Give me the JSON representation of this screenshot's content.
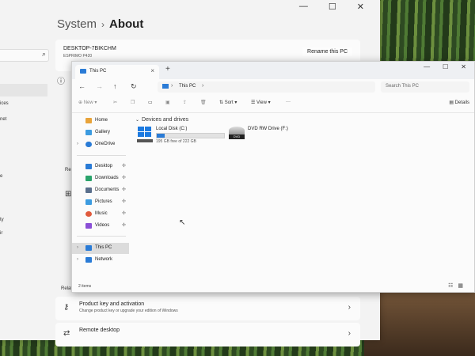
{
  "settings": {
    "breadcrumb": {
      "parent": "System",
      "current": "About"
    },
    "window_controls": [
      "—",
      "☐",
      "✕"
    ],
    "nav_fragments": [
      "ices",
      "net",
      "e",
      "ty",
      "ir"
    ],
    "device": {
      "name": "DESKTOP-7BIKCHM",
      "model": "ESPRIMO P420",
      "rename_label": "Rename this PC"
    },
    "section_label": "Re",
    "related_label": "Related",
    "cards": [
      {
        "title": "Product key and activation",
        "subtitle": "Change product key or upgrade your edition of Windows",
        "icon": "key-icon"
      },
      {
        "title": "Remote desktop",
        "subtitle": "",
        "icon": "remote-desktop-icon"
      }
    ]
  },
  "explorer": {
    "tab_title": "This PC",
    "new_tab": "+",
    "window_controls": [
      "—",
      "☐",
      "✕"
    ],
    "address": {
      "location": "This PC"
    },
    "search_placeholder": "Search This PC",
    "toolbar": {
      "new": "New",
      "sort": "Sort",
      "view": "View",
      "more": "···",
      "details": "Details"
    },
    "nav": [
      {
        "label": "Home",
        "icon": "home-icon",
        "color": "#e8a33a"
      },
      {
        "label": "Gallery",
        "icon": "gallery-icon",
        "color": "#3c9be0"
      },
      {
        "label": "OneDrive",
        "icon": "onedrive-icon",
        "color": "#2a7bd6"
      },
      {
        "label": "Desktop",
        "icon": "desktop-icon",
        "color": "#2a7bd6"
      },
      {
        "label": "Downloads",
        "icon": "downloads-icon",
        "color": "#2aa36b"
      },
      {
        "label": "Documents",
        "icon": "documents-icon",
        "color": "#5a6f8c"
      },
      {
        "label": "Pictures",
        "icon": "pictures-icon",
        "color": "#3c9be0"
      },
      {
        "label": "Music",
        "icon": "music-icon",
        "color": "#e05a3c"
      },
      {
        "label": "Videos",
        "icon": "videos-icon",
        "color": "#8a4fd6"
      },
      {
        "label": "This PC",
        "icon": "this-pc-icon",
        "color": "#2a7bd6"
      },
      {
        "label": "Network",
        "icon": "network-icon",
        "color": "#2a7bd6"
      }
    ],
    "group_title": "Devices and drives",
    "drives": [
      {
        "name": "Local Disk (C:)",
        "free_text": "195 GB free of 222 GB",
        "used_fraction": 0.12
      },
      {
        "name": "DVD RW Drive (F:)",
        "badge": "DVD"
      }
    ],
    "status": "2 items",
    "accent": "#2a7bd6"
  }
}
